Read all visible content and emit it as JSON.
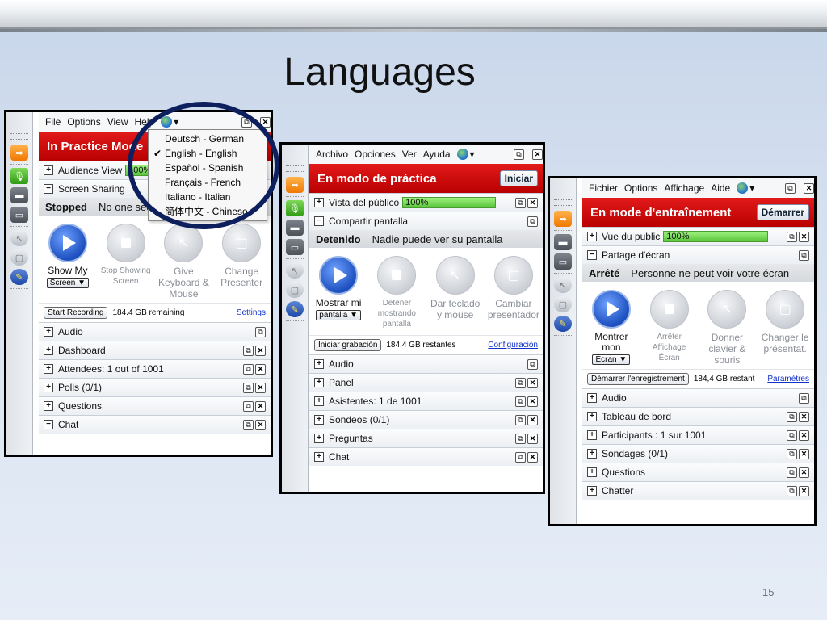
{
  "slide": {
    "title": "Languages",
    "page_number": "15"
  },
  "panel_en": {
    "menu": [
      "File",
      "Options",
      "View",
      "Help"
    ],
    "banner": "In Practice Mode",
    "audience_view": "Audience View",
    "audience_meter": "100%",
    "screen_sharing": "Screen Sharing",
    "status_state": "Stopped",
    "status_msg": "No one sees your screen",
    "share_buttons": [
      {
        "label": "Show My",
        "select": "Screen"
      },
      {
        "label": "Stop Showing Screen"
      },
      {
        "label": "Give Keyboard & Mouse"
      },
      {
        "label": "Change Presenter"
      }
    ],
    "record_button": "Start Recording",
    "remaining": "184.4 GB remaining",
    "settings_link": "Settings",
    "sections": [
      "Audio",
      "Dashboard",
      "Attendees:  1 out of 1001",
      "Polls (0/1)",
      "Questions",
      "Chat"
    ],
    "language_menu": {
      "items": [
        "Deutsch - German",
        "English - English",
        "Español - Spanish",
        "Français - French",
        "Italiano - Italian",
        "简体中文 - Chinese"
      ],
      "selected": "English - English"
    }
  },
  "panel_es": {
    "menu": [
      "Archivo",
      "Opciones",
      "Ver",
      "Ayuda"
    ],
    "banner": "En modo de práctica",
    "start_button": "Iniciar",
    "audience_view": "Vista del público",
    "audience_meter": "100%",
    "screen_sharing": "Compartir pantalla",
    "status_state": "Detenido",
    "status_msg": "Nadie puede ver su pantalla",
    "share_buttons": [
      {
        "label": "Mostrar mi",
        "select": "pantalla"
      },
      {
        "label": "Detener mostrando pantalla"
      },
      {
        "label": "Dar teclado y mouse"
      },
      {
        "label": "Cambiar presentador"
      }
    ],
    "record_button": "Iniciar grabación",
    "remaining": "184.4 GB restantes",
    "settings_link": "Configuración",
    "sections": [
      "Audio",
      "Panel",
      "Asistentes:  1 de 1001",
      "Sondeos (0/1)",
      "Preguntas",
      "Chat"
    ]
  },
  "panel_fr": {
    "menu": [
      "Fichier",
      "Options",
      "Affichage",
      "Aide"
    ],
    "banner": "En mode d'entraînement",
    "start_button": "Démarrer",
    "audience_view": "Vue du public",
    "audience_meter": "100%",
    "screen_sharing": "Partage d'écran",
    "status_state": "Arrêté",
    "status_msg": "Personne ne peut voir votre écran",
    "share_buttons": [
      {
        "label": "Montrer mon",
        "select": "Écran"
      },
      {
        "label": "Arrêter Affichage Écran"
      },
      {
        "label": "Donner clavier & souris"
      },
      {
        "label": "Changer le présentat."
      }
    ],
    "record_button": "Démarrer l'enregistrement",
    "remaining": "184,4 GB restant",
    "settings_link": "Paramètres",
    "sections": [
      "Audio",
      "Tableau de bord",
      "Participants :  1 sur 1001",
      "Sondages (0/1)",
      "Questions",
      "Chatter"
    ]
  }
}
